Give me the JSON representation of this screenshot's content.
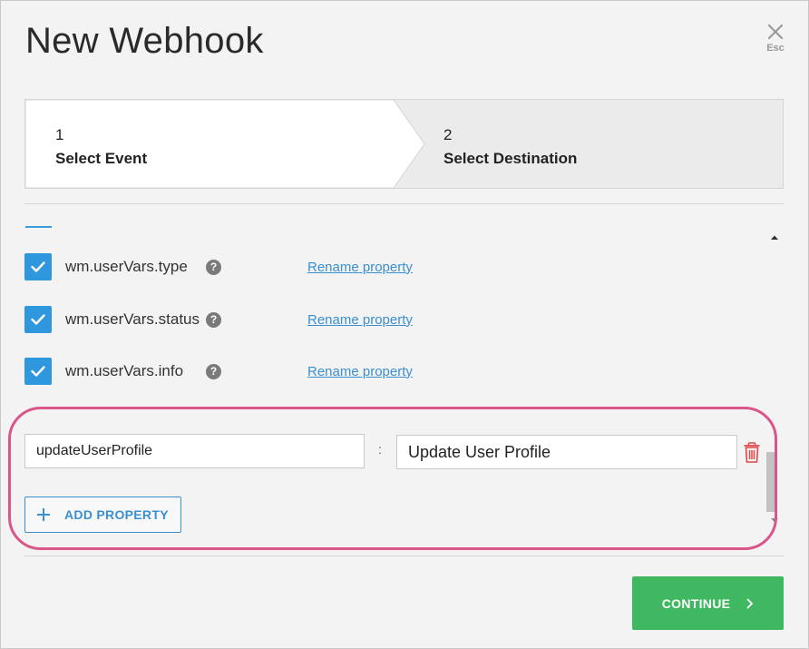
{
  "dialog": {
    "title": "New Webhook",
    "close_label": "Esc"
  },
  "stepper": {
    "steps": [
      {
        "number": "1",
        "label": "Select Event",
        "active": true
      },
      {
        "number": "2",
        "label": "Select Destination",
        "active": false
      }
    ]
  },
  "properties": [
    {
      "name": "wm.userVars.type",
      "checked": true,
      "link": "Rename property"
    },
    {
      "name": "wm.userVars.status",
      "checked": true,
      "link": "Rename property"
    },
    {
      "name": "wm.userVars.info",
      "checked": true,
      "link": "Rename property"
    }
  ],
  "mapping": {
    "key_value": "updateUserProfile",
    "separator": ":",
    "display_value": "Update User Profile"
  },
  "buttons": {
    "add_property": "ADD PROPERTY",
    "continue": "CONTINUE"
  },
  "icons": {
    "close": "close-icon",
    "help": "help-icon",
    "check": "check-icon",
    "trash": "trash-icon",
    "plus": "plus-icon",
    "chevron": "chevron-right-icon"
  },
  "colors": {
    "accent_blue": "#2e97de",
    "link_blue": "#3a8fd0",
    "continue_green": "#3fb861",
    "highlight_pink": "#d9558a",
    "trash_red": "#e04848"
  }
}
